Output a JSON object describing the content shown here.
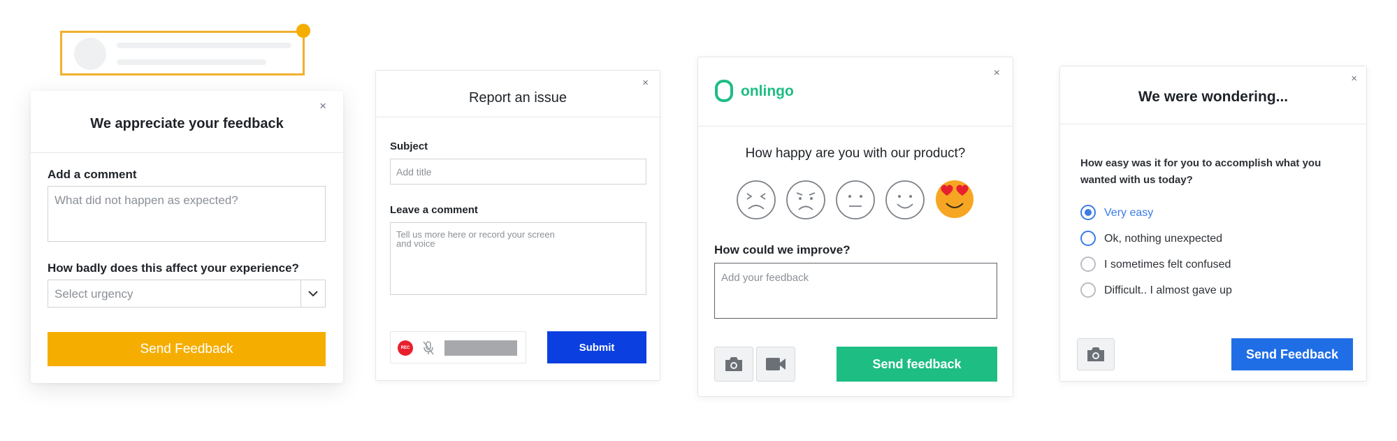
{
  "colors": {
    "orange": "#f5ae00",
    "blue_submit": "#0b3fe0",
    "green": "#1dbd84",
    "blue_send": "#1f6ee6",
    "radio_selected": "#3a7be8",
    "emoji_yellow": "#f6a623",
    "heart_red": "#e8202e"
  },
  "card1": {
    "title": "We appreciate your feedback",
    "close": "×",
    "comment_label": "Add a comment",
    "comment_placeholder": "What did not happen as expected?",
    "urgency_label": "How badly does this affect your experience?",
    "urgency_placeholder": "Select urgency",
    "send_label": "Send Feedback"
  },
  "card2": {
    "title": "Report an issue",
    "close": "×",
    "subject_label": "Subject",
    "subject_placeholder": "Add title",
    "comment_label": "Leave a comment",
    "comment_placeholder_line1": "Tell us more here or record your screen",
    "comment_placeholder_line2": "and voice",
    "rec_badge": "REC",
    "submit_label": "Submit"
  },
  "card3": {
    "brand": "onlingo",
    "close": "×",
    "question": "How happy are you with our product?",
    "faces": [
      "very-unhappy",
      "unhappy",
      "neutral",
      "happy",
      "love"
    ],
    "selected_face": "love",
    "improve_label": "How could we improve?",
    "improve_placeholder": "Add your feedback",
    "send_label": "Send feedback",
    "icons": [
      "camera-icon",
      "video-camera-icon"
    ]
  },
  "card4": {
    "title": "We were wondering...",
    "close": "×",
    "question": "How easy was it for you to accomplish what you wanted with us today?",
    "options": [
      {
        "label": "Very easy",
        "state": "selected"
      },
      {
        "label": "Ok, nothing unexpected",
        "state": "focused"
      },
      {
        "label": "I sometimes felt confused",
        "state": "default"
      },
      {
        "label": "Difficult.. I almost gave up",
        "state": "default"
      }
    ],
    "send_label": "Send Feedback",
    "icons": [
      "camera-icon"
    ]
  }
}
